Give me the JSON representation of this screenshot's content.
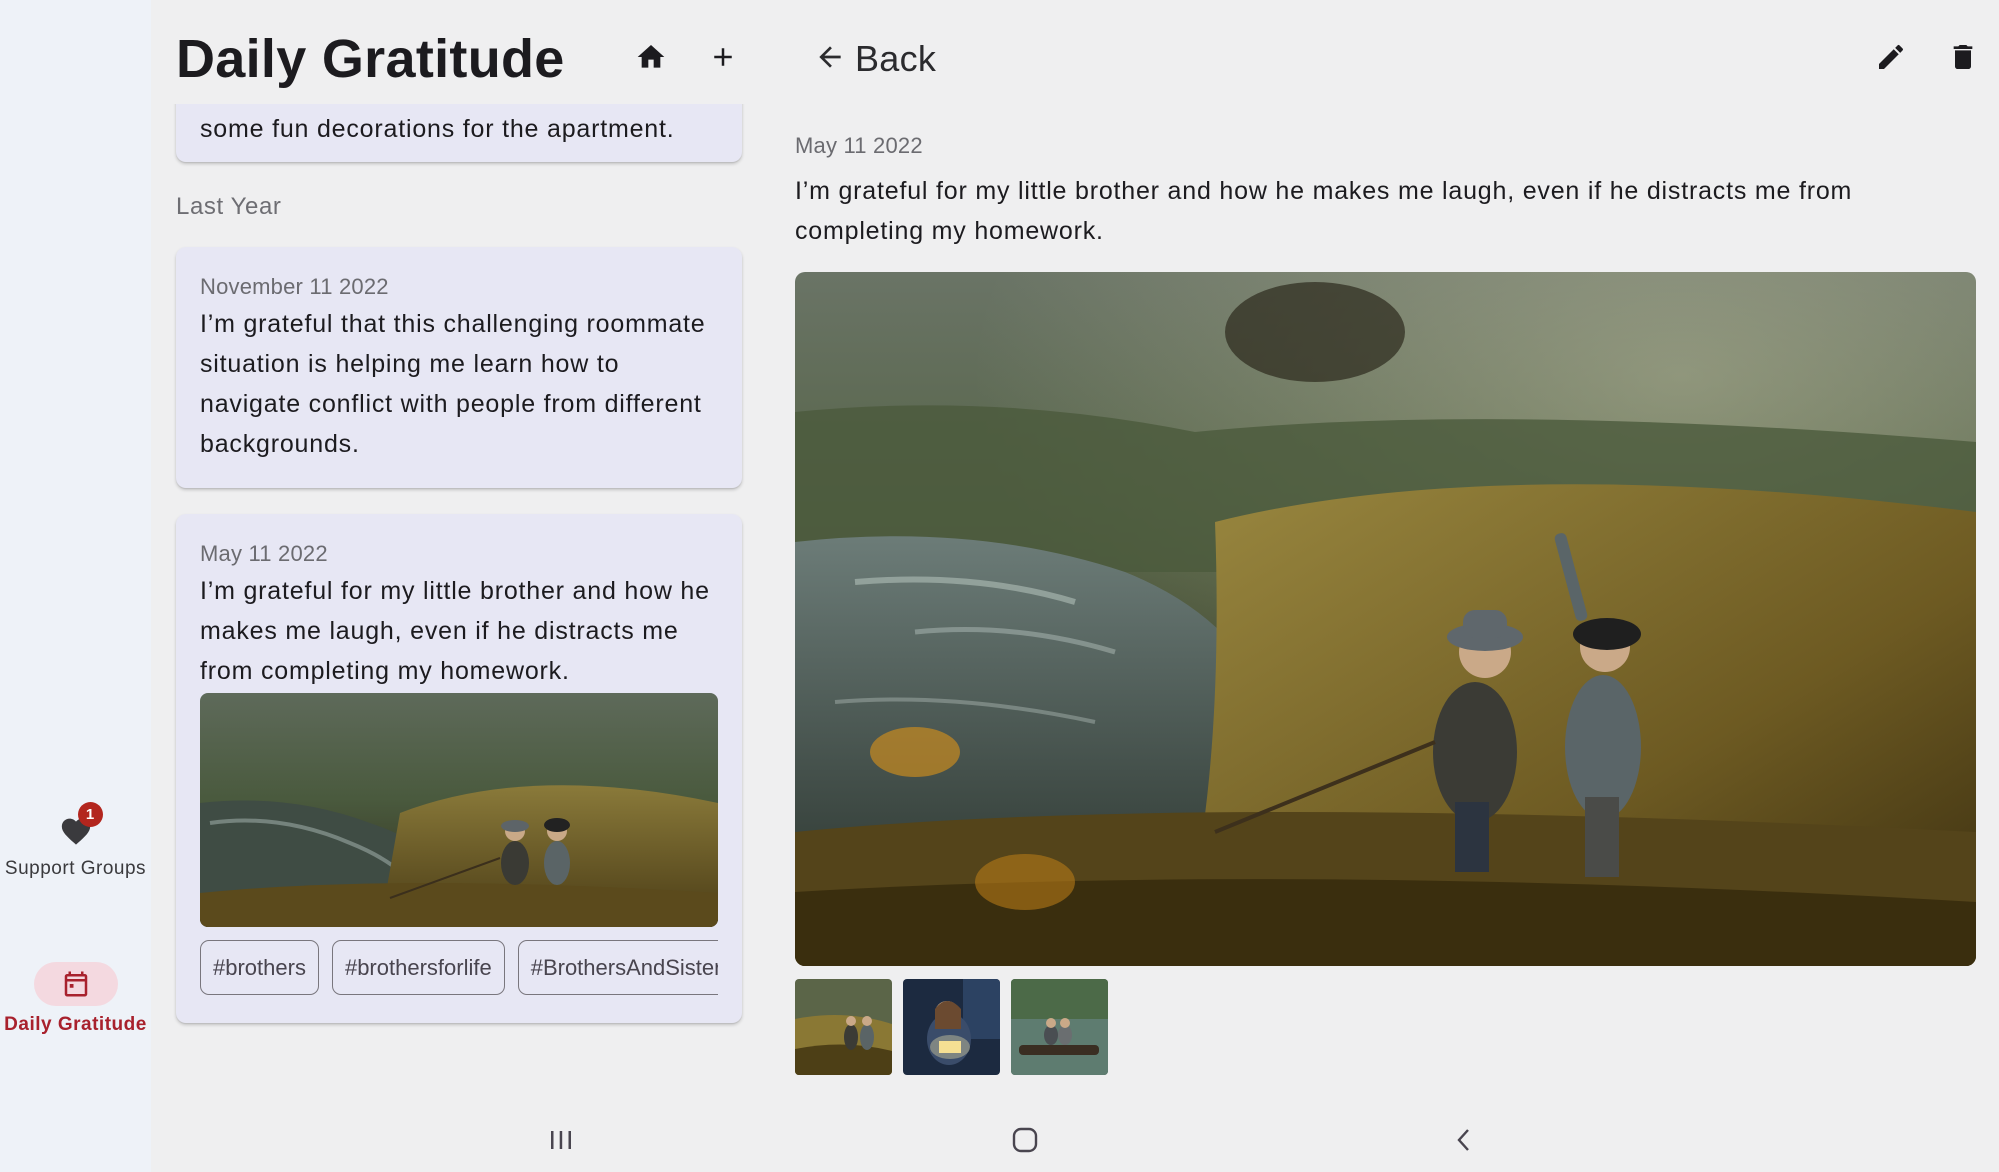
{
  "app": {
    "title": "Daily Gratitude"
  },
  "rail": {
    "items": [
      {
        "label": "Support Groups",
        "icon": "heart-icon",
        "badge": "1",
        "selected": false
      },
      {
        "label": "Daily Gratitude",
        "icon": "calendar-icon",
        "selected": true
      }
    ]
  },
  "list": {
    "header_icons": [
      "home-icon",
      "add-icon"
    ],
    "previous_card_tail": "some fun decorations for the apartment.",
    "section_label": "Last Year",
    "entries": [
      {
        "date": "November 11 2022",
        "text": "I’m grateful that this challenging roommate situation is helping me learn how to navigate conflict with people from different backgrounds."
      },
      {
        "date": "May 11 2022",
        "text": "I’m grateful for my little brother and how he makes me laugh, even if he distracts me from completing my homework.",
        "tags": [
          "#brothers",
          "#brothersforlife",
          "#BrothersAndSisters"
        ]
      }
    ]
  },
  "detail": {
    "back_label": "Back",
    "date": "May 11 2022",
    "text": "I’m grateful for my little brother and how he makes me laugh, even if he distracts me from completing my homework.",
    "action_icons": [
      "edit-icon",
      "delete-icon"
    ],
    "thumbnail_count": 3
  },
  "colors": {
    "accent": "#a8212d",
    "badge": "#b3261e",
    "rail_bg": "#eef2f8",
    "card_bg": "#e7e7f4",
    "page_bg": "#efeff0"
  }
}
